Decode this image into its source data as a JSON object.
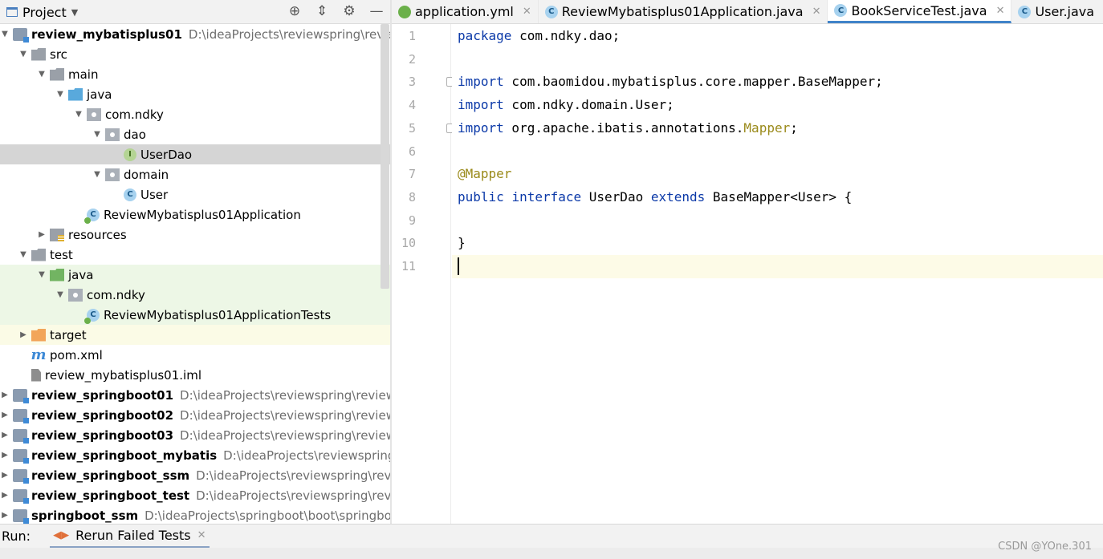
{
  "project_panel": {
    "title": "Project",
    "tree": [
      {
        "label": "review_mybatisplus01",
        "path": "D:\\ideaProjects\\reviewspring\\review_",
        "icon": "module-icon",
        "arrow": "▼",
        "bold": true
      },
      {
        "label": "src",
        "icon": "folder-icon",
        "arrow": "▼"
      },
      {
        "label": "main",
        "icon": "folder-icon",
        "arrow": "▼"
      },
      {
        "label": "java",
        "icon": "source-folder-icon",
        "arrow": "▼"
      },
      {
        "label": "com.ndky",
        "icon": "package-icon",
        "arrow": "▼"
      },
      {
        "label": "dao",
        "icon": "package-icon",
        "arrow": "▼"
      },
      {
        "label": "UserDao",
        "icon": "interface-icon",
        "arrow": "",
        "selected": true
      },
      {
        "label": "domain",
        "icon": "package-icon",
        "arrow": "▼"
      },
      {
        "label": "User",
        "icon": "class-icon",
        "arrow": ""
      },
      {
        "label": "ReviewMybatisplus01Application",
        "icon": "spring-boot-class-icon",
        "arrow": ""
      },
      {
        "label": "resources",
        "icon": "resources-folder-icon",
        "arrow": "▶"
      },
      {
        "label": "test",
        "icon": "folder-icon",
        "arrow": "▼"
      },
      {
        "label": "java",
        "icon": "test-source-folder-icon",
        "arrow": "▼",
        "testsrc": true
      },
      {
        "label": "com.ndky",
        "icon": "package-icon",
        "arrow": "▼",
        "testsrc": true
      },
      {
        "label": "ReviewMybatisplus01ApplicationTests",
        "icon": "spring-boot-class-icon",
        "arrow": "",
        "testsrc": true
      },
      {
        "label": "target",
        "icon": "excluded-folder-icon",
        "arrow": "▶",
        "excluded": true
      },
      {
        "label": "pom.xml",
        "icon": "maven-icon",
        "arrow": ""
      },
      {
        "label": "review_mybatisplus01.iml",
        "icon": "iml-file-icon",
        "arrow": ""
      },
      {
        "label": "review_springboot01",
        "path": "D:\\ideaProjects\\reviewspring\\review_s",
        "icon": "module-icon",
        "arrow": "▶",
        "bold": true
      },
      {
        "label": "review_springboot02",
        "path": "D:\\ideaProjects\\reviewspring\\review_s",
        "icon": "module-icon",
        "arrow": "▶",
        "bold": true
      },
      {
        "label": "review_springboot03",
        "path": "D:\\ideaProjects\\reviewspring\\review_s",
        "icon": "module-icon",
        "arrow": "▶",
        "bold": true
      },
      {
        "label": "review_springboot_mybatis",
        "path": "D:\\ideaProjects\\reviewspring\\re",
        "icon": "module-icon",
        "arrow": "▶",
        "bold": true
      },
      {
        "label": "review_springboot_ssm",
        "path": "D:\\ideaProjects\\reviewspring\\review",
        "icon": "module-icon",
        "arrow": "▶",
        "bold": true
      },
      {
        "label": "review_springboot_test",
        "path": "D:\\ideaProjects\\reviewspring\\review",
        "icon": "module-icon",
        "arrow": "▶",
        "bold": true
      },
      {
        "label": "springboot_ssm",
        "path": "D:\\ideaProjects\\springboot\\boot\\springboo",
        "icon": "module-icon",
        "arrow": "▶",
        "bold": true
      }
    ]
  },
  "tabs": [
    {
      "label": "application.yml",
      "icon": "yml-file-icon",
      "closable": true
    },
    {
      "label": "ReviewMybatisplus01Application.java",
      "icon": "spring-boot-class-icon",
      "closable": true
    },
    {
      "label": "BookServiceTest.java",
      "icon": "spring-boot-class-icon",
      "closable": true,
      "active": true
    },
    {
      "label": "User.java",
      "icon": "class-icon",
      "closable": true
    },
    {
      "label": "",
      "icon": "interface-icon",
      "closable": false
    }
  ],
  "editor": {
    "line_numbers": [
      "1",
      "2",
      "3",
      "4",
      "5",
      "6",
      "7",
      "8",
      "9",
      "10",
      "11"
    ],
    "lines": [
      [
        {
          "t": "package",
          "c": "kw"
        },
        {
          "t": " com.ndky.dao;"
        }
      ],
      [],
      [
        {
          "t": "import",
          "c": "kw"
        },
        {
          "t": " com.baomidou.mybatisplus.core.mapper.BaseMapper;"
        }
      ],
      [
        {
          "t": "import",
          "c": "kw"
        },
        {
          "t": " com.ndky.domain.User;"
        }
      ],
      [
        {
          "t": "import",
          "c": "kw"
        },
        {
          "t": " org.apache.ibatis.annotations."
        },
        {
          "t": "Mapper",
          "c": "ann"
        },
        {
          "t": ";"
        }
      ],
      [],
      [
        {
          "t": "@Mapper",
          "c": "ann"
        }
      ],
      [
        {
          "t": "public",
          "c": "kw"
        },
        {
          "t": " "
        },
        {
          "t": "interface",
          "c": "kw"
        },
        {
          "t": " UserDao "
        },
        {
          "t": "extends",
          "c": "kw"
        },
        {
          "t": " BaseMapper<User> {"
        }
      ],
      [],
      [
        {
          "t": "}"
        }
      ],
      []
    ],
    "current_line": 11
  },
  "run_panel": {
    "label": "Run:",
    "tab_label": "Rerun Failed Tests"
  },
  "watermark": "CSDN @YOne.301"
}
